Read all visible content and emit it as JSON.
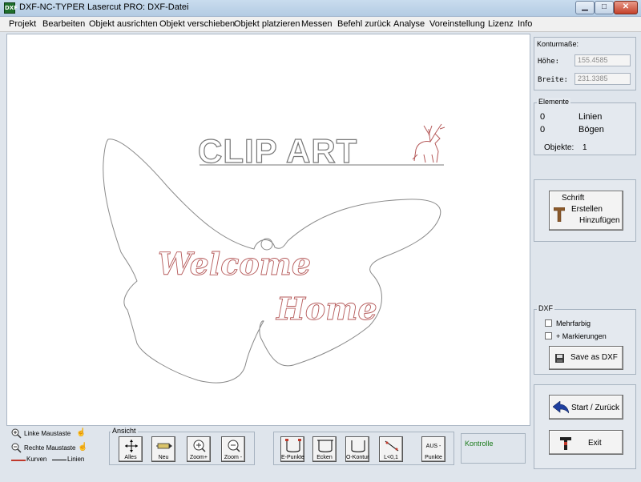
{
  "window": {
    "title": "DXF-NC-TYPER Lasercut PRO: DXF-Datei",
    "app_icon_text": "DXF",
    "minimize": "▁",
    "maximize": "□",
    "close": "✕"
  },
  "menu": [
    "Projekt",
    "Bearbeiten",
    "Objekt ausrichten",
    "Objekt verschieben",
    "Objekt platzieren",
    "Messen",
    "Befehl zurück",
    "Analyse",
    "Voreinstellung",
    "Lizenz",
    "Info"
  ],
  "canvas": {
    "headline": "CLIP ART",
    "script_line1": "Welcome",
    "script_line2": "Home"
  },
  "konturmasse": {
    "title": "Konturmaße:",
    "hoehe_label": "Höhe:",
    "hoehe_value": "155.4585",
    "breite_label": "Breite:",
    "breite_value": "231.3385"
  },
  "elemente": {
    "title": "Elemente",
    "linien_count": "0",
    "linien_label": "Linien",
    "boegen_count": "0",
    "boegen_label": "Bögen",
    "objekte_label": "Objekte:",
    "objekte_count": "1"
  },
  "schrift_button": {
    "line1": "Schrift",
    "line2": "Erstellen",
    "line3": "Hinzufügen"
  },
  "dxf": {
    "title": "DXF",
    "mehrfarbig": "Mehrfarbig",
    "markierungen": "+ Markierungen",
    "save": "Save as DXF"
  },
  "start_button": "Start / Zurück",
  "exit_button": "Exit",
  "legend": {
    "left_mouse": "Linke Maustaste",
    "right_mouse": "Rechte Maustaste",
    "curves": "Kurven",
    "lines": "Linien",
    "curves_color": "#c0392b"
  },
  "ansicht": {
    "title": "Ansicht",
    "buttons": [
      "Alles",
      "Neu",
      "Zoom+",
      "Zoom -"
    ]
  },
  "tools": {
    "buttons": [
      "E-Punkte",
      "Ecken",
      "O-Kontur",
      "L<0,1",
      "Punkte"
    ],
    "aus_label": "AUS -"
  },
  "kontrolle": {
    "label": "Kontrolle",
    "color": "#1a7a1a"
  }
}
